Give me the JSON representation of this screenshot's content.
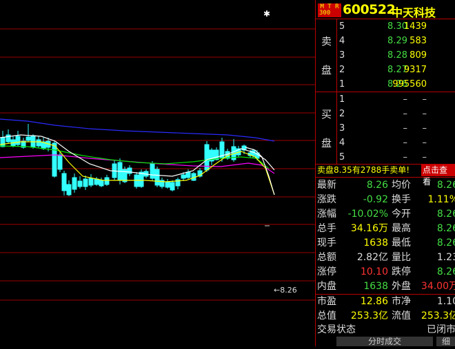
{
  "stock": {
    "badge_line1": "M T R",
    "badge_line2": "300",
    "code": "600522",
    "name": "中天科技"
  },
  "sell_label_1": "卖",
  "sell_label_2": "盘",
  "buy_label_1": "买",
  "buy_label_2": "盘",
  "asks": [
    {
      "level": "5",
      "price": "8.30",
      "vol": "1439"
    },
    {
      "level": "4",
      "price": "8.29",
      "vol": "583"
    },
    {
      "level": "3",
      "price": "8.28",
      "vol": "809"
    },
    {
      "level": "2",
      "price": "8.27",
      "vol": "9317"
    },
    {
      "level": "1",
      "price": "8.26",
      "vol": "995560"
    }
  ],
  "bids": [
    {
      "level": "1",
      "price": "–",
      "vol": "–"
    },
    {
      "level": "2",
      "price": "–",
      "vol": "–"
    },
    {
      "level": "3",
      "price": "–",
      "vol": "–"
    },
    {
      "level": "4",
      "price": "–",
      "vol": "–"
    },
    {
      "level": "5",
      "price": "–",
      "vol": "–"
    }
  ],
  "banner": {
    "text": "卖盘8.35有2788手卖单!",
    "button": "点击查看"
  },
  "quotes": [
    {
      "k1": "最新",
      "v1": "8.26",
      "c1": "green",
      "k2": "均价",
      "v2": "8.26",
      "c2": "green"
    },
    {
      "k1": "涨跌",
      "v1": "-0.92",
      "c1": "green",
      "k2": "换手",
      "v2": "1.11%",
      "c2": "yellow"
    },
    {
      "k1": "涨幅",
      "v1": "-10.02%",
      "c1": "green",
      "k2": "今开",
      "v2": "8.26",
      "c2": "green"
    },
    {
      "k1": "总手",
      "v1": "34.16万",
      "c1": "yellow",
      "k2": "最高",
      "v2": "8.26",
      "c2": "green"
    },
    {
      "k1": "现手",
      "v1": "1638",
      "c1": "yellow",
      "k2": "最低",
      "v2": "8.26",
      "c2": "green"
    },
    {
      "k1": "总额",
      "v1": "2.82亿",
      "c1": "white",
      "k2": "量比",
      "v2": "1.23",
      "c2": "white"
    },
    {
      "k1": "涨停",
      "v1": "10.10",
      "c1": "red",
      "k2": "跌停",
      "v2": "8.26",
      "c2": "green"
    },
    {
      "k1": "内盘",
      "v1": "1638",
      "c1": "green",
      "k2": "外盘",
      "v2": "34.00万",
      "c2": "red"
    }
  ],
  "quotes2": [
    {
      "k1": "市盈",
      "v1": "12.86",
      "k2": "市净",
      "v2": "1.10"
    },
    {
      "k1": "总值",
      "v1": "253.3亿",
      "k2": "流值",
      "v2": "253.3亿"
    }
  ],
  "status": {
    "label": "交易状态",
    "value": "已闭市"
  },
  "tabs": {
    "fenshi": "分时成交",
    "detail": "细"
  },
  "chart_price_label": "←8.26",
  "chart_data": {
    "type": "candlestick",
    "last_price_marker": "8.26",
    "candles_note": "daily candlesticks with moving average lines"
  }
}
